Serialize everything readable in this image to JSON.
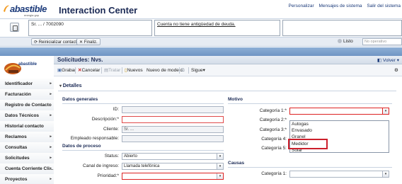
{
  "header": {
    "logo_text": "abastible",
    "logo_sub": "energia gnp",
    "app_title": "Interaction Center",
    "links": [
      "Personalizar",
      "Mensajes de sistema",
      "Salir del sistema"
    ]
  },
  "interaction": {
    "caller": "Sr. ... / 7002090",
    "message": "Cuenta no tiene antigüedad de deuda.",
    "reinit_label": "Reinicializar contacto",
    "final_label": "Finaliz.",
    "status_label": "Listo",
    "status_value": "No operativo"
  },
  "nav": {
    "logo_text": "abastible",
    "items": [
      "Identificador",
      "Facturación",
      "Registro de Contacto",
      "Datos Técnicos",
      "Historial contacto",
      "Reclamos",
      "Consultas",
      "Solicitudes",
      "Cuenta Corriente Cli...",
      "Proyectos"
    ]
  },
  "main": {
    "title": "Solicitudes: Nvs.",
    "back_label": "Volver",
    "toolbar": {
      "save": "Grabar",
      "cancel": "Cancelar",
      "process": "Tratar",
      "new": "Nuevos",
      "new_from_model": "Nuevo de modelo",
      "next": "Sigue"
    },
    "details_label": "Detalles",
    "general": {
      "section": "Datos generales",
      "id_label": "ID:",
      "id_value": "",
      "desc_label": "Descripción:*",
      "desc_value": "",
      "client_label": "Cliente:",
      "client_value": "Sr. ...",
      "employee_label": "Empleado responsable:",
      "employee_value": ""
    },
    "process": {
      "section": "Datos de proceso",
      "status_label": "Status:",
      "status_value": "Abierto",
      "channel_label": "Canal de ingreso:",
      "channel_value": "Llamada telefónica",
      "priority_label": "Prioridad:*",
      "priority_value": ""
    },
    "motivo": {
      "section": "Motivo",
      "cat1_label": "Categoría 1:*",
      "cat2_label": "Categoría 2:*",
      "cat3_label": "Categoría 3:*",
      "cat4_label": "Categoría 4:",
      "cat5_label": "Categoría 5:",
      "dropdown_options": [
        "",
        "Autogas",
        "Envasado",
        "Granel",
        "Medidor",
        "Solar"
      ],
      "highlighted_option": "Medidor"
    },
    "causas": {
      "section": "Causas",
      "cat1_label": "Categoría 1:"
    }
  },
  "colors": {
    "brand_blue": "#1b3a7a",
    "brand_orange": "#f39a1e",
    "band_blue": "#7ea2cd",
    "highlight_red": "#cc1f2b"
  }
}
